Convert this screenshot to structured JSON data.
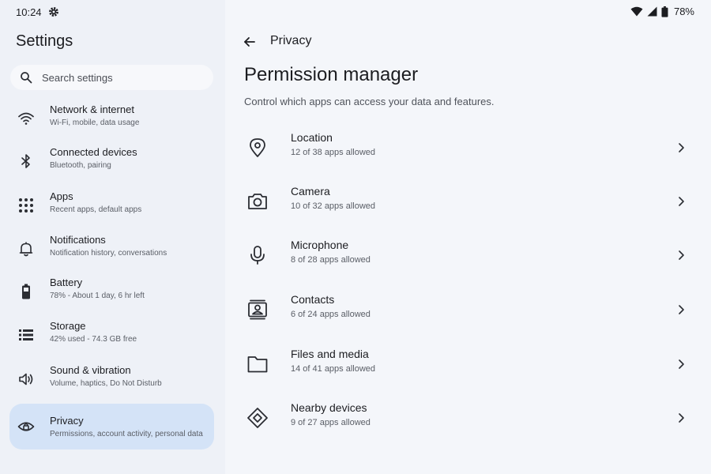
{
  "status_bar": {
    "time": "10:24",
    "battery_percent": "78%",
    "icons": [
      "gear-icon",
      "wifi-icon",
      "signal-icon",
      "battery-icon"
    ]
  },
  "left_pane": {
    "title": "Settings",
    "search": {
      "placeholder": "Search settings"
    },
    "items": [
      {
        "label": "Network & internet",
        "sub": "Wi-Fi, mobile, data usage",
        "icon": "wifi-icon"
      },
      {
        "label": "Connected devices",
        "sub": "Bluetooth, pairing",
        "icon": "bluetooth-icon"
      },
      {
        "label": "Apps",
        "sub": "Recent apps, default apps",
        "icon": "apps-grid-icon"
      },
      {
        "label": "Notifications",
        "sub": "Notification history, conversations",
        "icon": "bell-icon"
      },
      {
        "label": "Battery",
        "sub": "78% - About 1 day, 6 hr left",
        "icon": "battery-icon"
      },
      {
        "label": "Storage",
        "sub": "42% used - 74.3 GB free",
        "icon": "storage-list-icon"
      },
      {
        "label": "Sound & vibration",
        "sub": "Volume, haptics, Do Not Disturb",
        "icon": "speaker-icon"
      },
      {
        "label": "Privacy",
        "sub": "Permissions, account activity, personal data",
        "icon": "privacy-eye-lock-icon",
        "selected": true
      }
    ]
  },
  "right_pane": {
    "breadcrumb": "Privacy",
    "title": "Permission manager",
    "description": "Control which apps can access your data and features.",
    "permissions": [
      {
        "label": "Location",
        "sub": "12 of 38 apps allowed",
        "icon": "location-pin-icon"
      },
      {
        "label": "Camera",
        "sub": "10 of 32 apps allowed",
        "icon": "camera-icon"
      },
      {
        "label": "Microphone",
        "sub": "8 of 28 apps allowed",
        "icon": "microphone-icon"
      },
      {
        "label": "Contacts",
        "sub": "6 of 24 apps allowed",
        "icon": "contacts-icon"
      },
      {
        "label": "Files and media",
        "sub": "14 of 41 apps allowed",
        "icon": "folder-icon"
      },
      {
        "label": "Nearby devices",
        "sub": "9 of 27 apps allowed",
        "icon": "nearby-devices-icon"
      }
    ]
  },
  "colors": {
    "left_background": "#eef1f7",
    "right_background": "#f4f6fa",
    "selected_item": "#d4e3f7",
    "primary_text": "#1c1d21",
    "secondary_text": "#5a5e66"
  }
}
